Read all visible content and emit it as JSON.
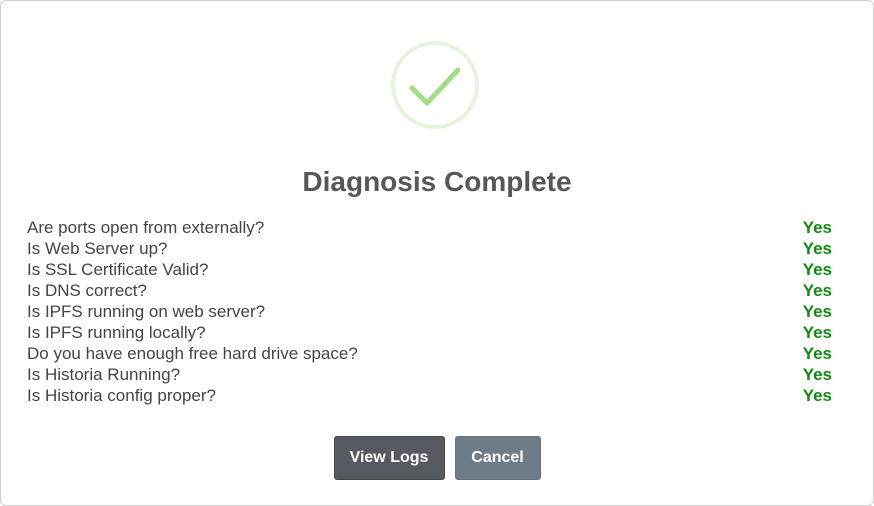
{
  "dialog": {
    "status_icon": "checkmark-circle-icon",
    "title": "Diagnosis Complete",
    "checks": [
      {
        "question": "Are ports open from externally?",
        "result": "Yes"
      },
      {
        "question": "Is Web Server up?",
        "result": "Yes"
      },
      {
        "question": "Is SSL Certificate Valid?",
        "result": "Yes"
      },
      {
        "question": "Is DNS correct?",
        "result": "Yes"
      },
      {
        "question": "Is IPFS running on web server?",
        "result": "Yes"
      },
      {
        "question": "Is IPFS running locally?",
        "result": "Yes"
      },
      {
        "question": "Do you have enough free hard drive space?",
        "result": "Yes"
      },
      {
        "question": "Is Historia Running?",
        "result": "Yes"
      },
      {
        "question": "Is Historia config proper?",
        "result": "Yes"
      }
    ],
    "buttons": {
      "view_logs_label": "View Logs",
      "cancel_label": "Cancel"
    }
  },
  "colors": {
    "success_green": "#108a10",
    "icon_check": "#a5dc86",
    "icon_ring": "#e8f5e0",
    "title_text": "#575757",
    "primary_button": "#545a60",
    "secondary_button": "#6e7c88"
  }
}
